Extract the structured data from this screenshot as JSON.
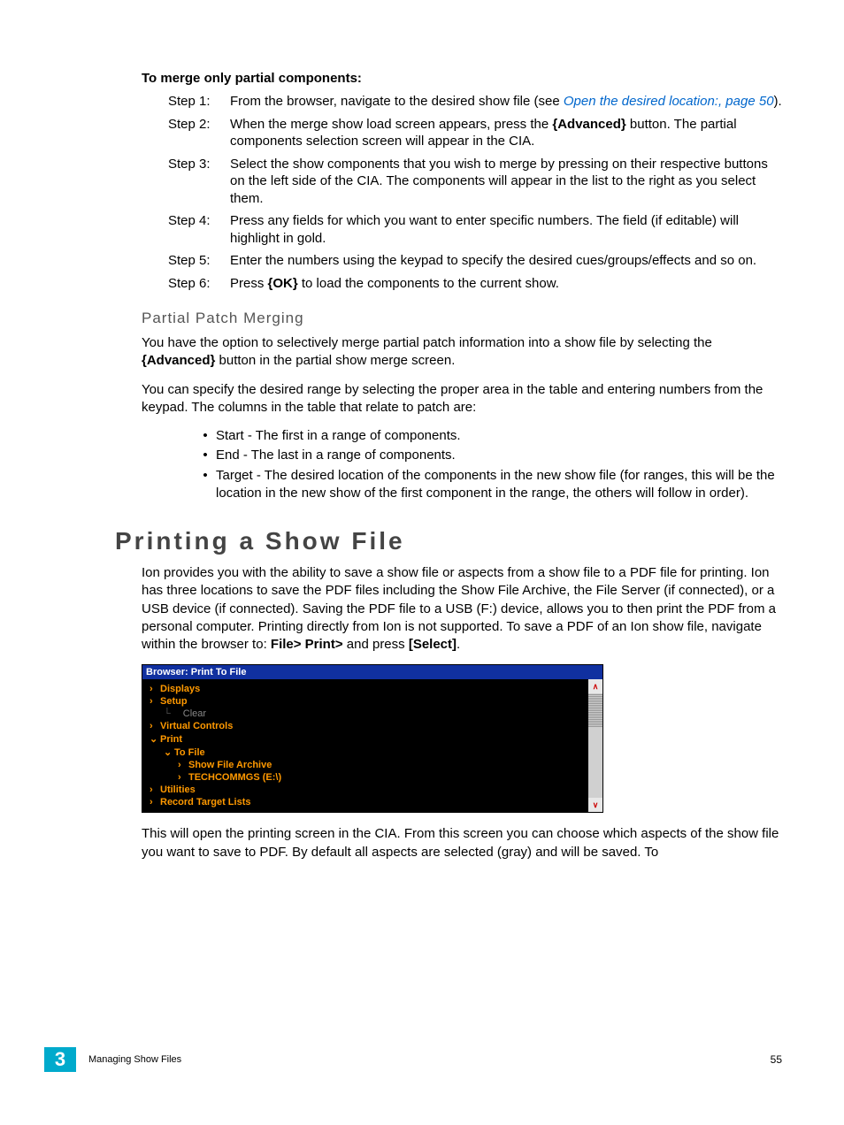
{
  "mergeHeading": "To merge only partial components:",
  "steps": [
    {
      "label": "Step 1:",
      "pre": "From the browser, navigate to the desired show file (see ",
      "link": "Open the desired location:, page 50",
      "post": ")."
    },
    {
      "label": "Step 2:",
      "pre": "When the merge show load screen appears, press the ",
      "bold": "{Advanced}",
      "post": " button. The partial components selection screen will appear in the CIA."
    },
    {
      "label": "Step 3:",
      "text": "Select the show components that you wish to merge by pressing on their respective buttons on the left side of the CIA. The components will appear in the list to the right as you select them."
    },
    {
      "label": "Step 4:",
      "text": "Press any fields for which you want to enter specific numbers. The field (if editable) will highlight in gold."
    },
    {
      "label": "Step 5:",
      "text": "Enter the numbers using the keypad to specify the desired cues/groups/effects and so on."
    },
    {
      "label": "Step 6:",
      "pre": "Press ",
      "bold": "{OK}",
      "post": " to load the components to the current show."
    }
  ],
  "partialHeading": "Partial Patch Merging",
  "partialPara1a": "You have the option to selectively merge partial patch information into a show file by selecting the ",
  "partialPara1bold": "{Advanced}",
  "partialPara1b": " button in the partial show merge screen.",
  "partialPara2": "You can specify the desired range by selecting the proper area in the table and entering numbers from the keypad. The columns in the table that relate to patch are:",
  "bullets": [
    "Start - The first in a range of components.",
    "End - The last in a range of components.",
    "Target - The desired location of the components in the new show file (for ranges, this will be the location in the new show of the first component in the range, the others will follow in order)."
  ],
  "mainHeading": "Printing a Show File",
  "printPara1a": "Ion provides you with the ability to save a show file or aspects from a show file to a PDF file for printing. Ion has three locations to save the PDF files including the Show File Archive, the File Server (if connected), or a USB device (if connected). Saving the PDF file to a USB (F:) device, allows you to then print the PDF from a personal computer. Printing directly from Ion is not supported. To save a PDF of an Ion show file, navigate within the browser to: ",
  "printPara1bold1": "File> Print>",
  "printPara1b": " and press ",
  "printPara1bold2": "[Select]",
  "printPara1c": ".",
  "browser": {
    "title": "Browser: Print To File",
    "items": [
      {
        "indent": 0,
        "arrow": "right",
        "style": "orange",
        "label": "Displays"
      },
      {
        "indent": 0,
        "arrow": "right",
        "style": "orange",
        "label": "Setup"
      },
      {
        "indent": 1,
        "arrow": "",
        "style": "gray",
        "label": "Clear",
        "line": true
      },
      {
        "indent": 0,
        "arrow": "right",
        "style": "orange",
        "label": "Virtual Controls"
      },
      {
        "indent": 0,
        "arrow": "down",
        "style": "orange",
        "label": "Print"
      },
      {
        "indent": 1,
        "arrow": "down",
        "style": "orange",
        "label": "To File"
      },
      {
        "indent": 2,
        "arrow": "right",
        "style": "orange",
        "label": "Show File Archive"
      },
      {
        "indent": 2,
        "arrow": "right",
        "style": "orange",
        "label": "TECHCOMMGS (E:\\)"
      },
      {
        "indent": 0,
        "arrow": "right",
        "style": "orange",
        "label": "Utilities"
      },
      {
        "indent": 0,
        "arrow": "right",
        "style": "orange",
        "label": "Record Target Lists"
      }
    ],
    "scrollUp": "∧",
    "scrollDown": "∨"
  },
  "printPara2": "This will open the printing screen in the CIA. From this screen you can choose which aspects of the show file you want to save to PDF. By default all aspects are selected (gray) and will be saved. To",
  "footer": {
    "chapter": "3",
    "title": "Managing Show Files",
    "page": "55"
  }
}
